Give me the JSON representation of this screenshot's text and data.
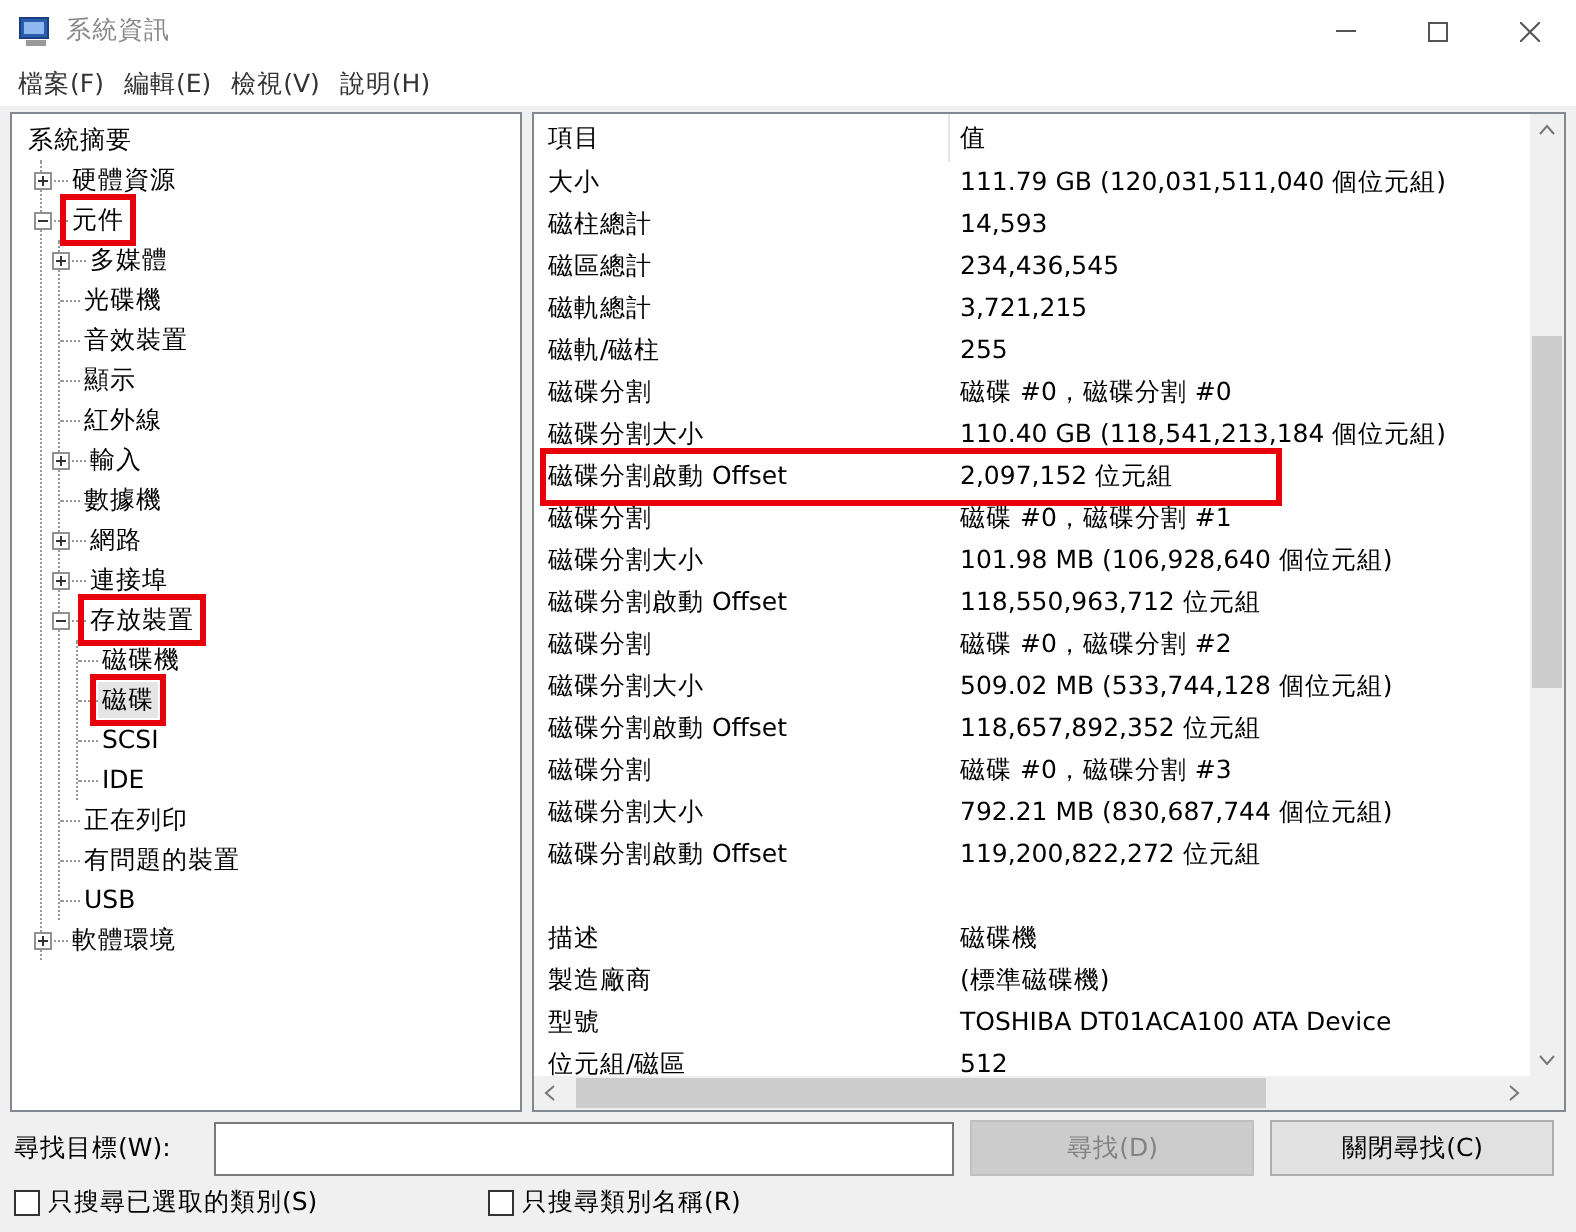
{
  "window": {
    "title": "系統資訊"
  },
  "menu": [
    "檔案(F)",
    "編輯(E)",
    "檢視(V)",
    "說明(H)"
  ],
  "tree": [
    {
      "label": "系統摘要",
      "selected": false,
      "highlighted": false,
      "children": [
        {
          "label": "硬體資源",
          "expanded": false,
          "selected": false,
          "highlighted": false
        },
        {
          "label": "元件",
          "expanded": true,
          "selected": false,
          "highlighted": true,
          "children": [
            {
              "label": "多媒體",
              "expanded": false,
              "selected": false,
              "highlighted": false
            },
            {
              "label": "光碟機",
              "selected": false,
              "highlighted": false
            },
            {
              "label": "音效裝置",
              "selected": false,
              "highlighted": false
            },
            {
              "label": "顯示",
              "selected": false,
              "highlighted": false
            },
            {
              "label": "紅外線",
              "selected": false,
              "highlighted": false
            },
            {
              "label": "輸入",
              "expanded": false,
              "selected": false,
              "highlighted": false
            },
            {
              "label": "數據機",
              "selected": false,
              "highlighted": false
            },
            {
              "label": "網路",
              "expanded": false,
              "selected": false,
              "highlighted": false
            },
            {
              "label": "連接埠",
              "expanded": false,
              "selected": false,
              "highlighted": false
            },
            {
              "label": "存放裝置",
              "expanded": true,
              "selected": false,
              "highlighted": true,
              "children": [
                {
                  "label": "磁碟機",
                  "selected": false,
                  "highlighted": false
                },
                {
                  "label": "磁碟",
                  "selected": true,
                  "highlighted": true
                },
                {
                  "label": "SCSI",
                  "selected": false,
                  "highlighted": false
                },
                {
                  "label": "IDE",
                  "selected": false,
                  "highlighted": false
                }
              ]
            },
            {
              "label": "正在列印",
              "selected": false,
              "highlighted": false
            },
            {
              "label": "有問題的裝置",
              "selected": false,
              "highlighted": false
            },
            {
              "label": "USB",
              "selected": false,
              "highlighted": false
            }
          ]
        },
        {
          "label": "軟體環境",
          "expanded": false,
          "selected": false,
          "highlighted": false
        }
      ]
    }
  ],
  "table": {
    "columns": [
      "項目",
      "值"
    ],
    "rows": [
      {
        "kind": "data",
        "item": "大小",
        "value": "111.79 GB (120,031,511,040 個位元組)",
        "highlighted": false
      },
      {
        "kind": "data",
        "item": "磁柱總計",
        "value": "14,593",
        "highlighted": false
      },
      {
        "kind": "data",
        "item": "磁區總計",
        "value": "234,436,545",
        "highlighted": false
      },
      {
        "kind": "data",
        "item": "磁軌總計",
        "value": "3,721,215",
        "highlighted": false
      },
      {
        "kind": "data",
        "item": "磁軌/磁柱",
        "value": "255",
        "highlighted": false
      },
      {
        "kind": "data",
        "item": "磁碟分割",
        "value": "磁碟 #0，磁碟分割 #0",
        "highlighted": false
      },
      {
        "kind": "data",
        "item": "磁碟分割大小",
        "value": "110.40 GB (118,541,213,184 個位元組)",
        "highlighted": false
      },
      {
        "kind": "data",
        "item": "磁碟分割啟動 Offset",
        "value": "2,097,152 位元組",
        "highlighted": true
      },
      {
        "kind": "data",
        "item": "磁碟分割",
        "value": "磁碟 #0，磁碟分割 #1",
        "highlighted": false
      },
      {
        "kind": "data",
        "item": "磁碟分割大小",
        "value": "101.98 MB (106,928,640 個位元組)",
        "highlighted": false
      },
      {
        "kind": "data",
        "item": "磁碟分割啟動 Offset",
        "value": "118,550,963,712 位元組",
        "highlighted": false
      },
      {
        "kind": "data",
        "item": "磁碟分割",
        "value": "磁碟 #0，磁碟分割 #2",
        "highlighted": false
      },
      {
        "kind": "data",
        "item": "磁碟分割大小",
        "value": "509.02 MB (533,744,128 個位元組)",
        "highlighted": false
      },
      {
        "kind": "data",
        "item": "磁碟分割啟動 Offset",
        "value": "118,657,892,352 位元組",
        "highlighted": false
      },
      {
        "kind": "data",
        "item": "磁碟分割",
        "value": "磁碟 #0，磁碟分割 #3",
        "highlighted": false
      },
      {
        "kind": "data",
        "item": "磁碟分割大小",
        "value": "792.21 MB (830,687,744 個位元組)",
        "highlighted": false
      },
      {
        "kind": "data",
        "item": "磁碟分割啟動 Offset",
        "value": "119,200,822,272 位元組",
        "highlighted": false
      },
      {
        "kind": "gap"
      },
      {
        "kind": "data",
        "item": "描述",
        "value": "磁碟機",
        "highlighted": false
      },
      {
        "kind": "data",
        "item": "製造廠商",
        "value": "(標準磁碟機)",
        "highlighted": false
      },
      {
        "kind": "data",
        "item": "型號",
        "value": "TOSHIBA DT01ACA100 ATA Device",
        "highlighted": false
      },
      {
        "kind": "data",
        "item": "位元組/磁區",
        "value": "512",
        "highlighted": false
      }
    ]
  },
  "find": {
    "label": "尋找目標(W):",
    "buttons": [
      {
        "label": "尋找(D)",
        "disabled": true
      },
      {
        "label": "關閉尋找(C)",
        "disabled": false
      }
    ],
    "options": [
      {
        "label": "只搜尋已選取的類別(S)",
        "checked": false
      },
      {
        "label": "只搜尋類別名稱(R)",
        "checked": false
      }
    ]
  }
}
